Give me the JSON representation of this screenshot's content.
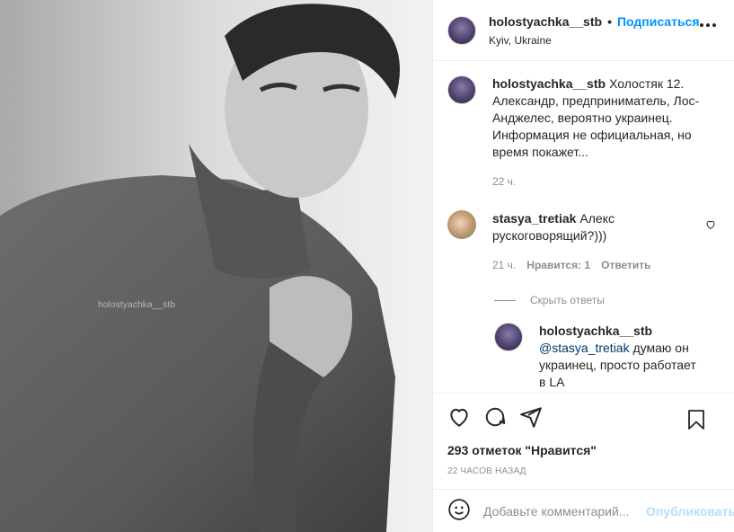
{
  "post": {
    "username": "holostyachka__stb",
    "follow_label": "Подписаться",
    "separator": "•",
    "location": "Kyiv, Ukraine",
    "watermark": "holostyachka__stb"
  },
  "caption": {
    "username": "holostyachka__stb",
    "text": "Холостяк 12. Александр, предприниматель, Лос-Анджелес, вероятно украинец. Информация не официальная, но время покажет...",
    "time": "22 ч."
  },
  "comments": [
    {
      "username": "stasya_tretiak",
      "text": "Алекс рускоговорящий?)))",
      "time": "21 ч.",
      "likes_label": "Нравится: 1",
      "reply_label": "Ответить"
    }
  ],
  "hide_replies_label": "Скрыть ответы",
  "reply": {
    "username": "holostyachka__stb",
    "mention": "@stasya_tretiak",
    "text": " думаю он украинец, просто работает в LA"
  },
  "likes_text": "293 отметок \"Нравится\"",
  "time_ago": "22 ЧАСОВ НАЗАД",
  "comment_box": {
    "placeholder": "Добавьте комментарий...",
    "publish_label": "Опубликовать"
  },
  "icons": [
    "heart-icon",
    "comment-icon",
    "share-icon",
    "bookmark-icon",
    "emoji-icon",
    "more-icon"
  ]
}
